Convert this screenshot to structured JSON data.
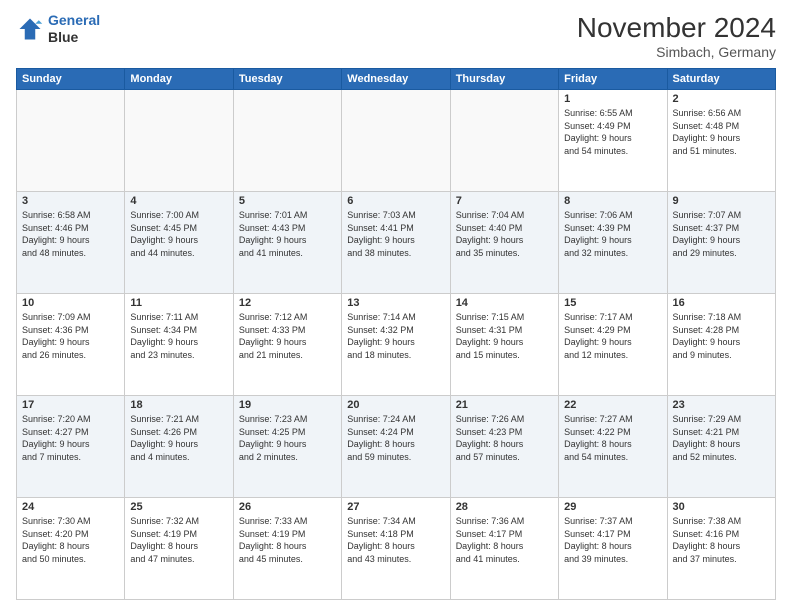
{
  "logo": {
    "line1": "General",
    "line2": "Blue"
  },
  "header": {
    "month_year": "November 2024",
    "location": "Simbach, Germany"
  },
  "weekdays": [
    "Sunday",
    "Monday",
    "Tuesday",
    "Wednesday",
    "Thursday",
    "Friday",
    "Saturday"
  ],
  "weeks": [
    [
      {
        "day": "",
        "info": ""
      },
      {
        "day": "",
        "info": ""
      },
      {
        "day": "",
        "info": ""
      },
      {
        "day": "",
        "info": ""
      },
      {
        "day": "",
        "info": ""
      },
      {
        "day": "1",
        "info": "Sunrise: 6:55 AM\nSunset: 4:49 PM\nDaylight: 9 hours\nand 54 minutes."
      },
      {
        "day": "2",
        "info": "Sunrise: 6:56 AM\nSunset: 4:48 PM\nDaylight: 9 hours\nand 51 minutes."
      }
    ],
    [
      {
        "day": "3",
        "info": "Sunrise: 6:58 AM\nSunset: 4:46 PM\nDaylight: 9 hours\nand 48 minutes."
      },
      {
        "day": "4",
        "info": "Sunrise: 7:00 AM\nSunset: 4:45 PM\nDaylight: 9 hours\nand 44 minutes."
      },
      {
        "day": "5",
        "info": "Sunrise: 7:01 AM\nSunset: 4:43 PM\nDaylight: 9 hours\nand 41 minutes."
      },
      {
        "day": "6",
        "info": "Sunrise: 7:03 AM\nSunset: 4:41 PM\nDaylight: 9 hours\nand 38 minutes."
      },
      {
        "day": "7",
        "info": "Sunrise: 7:04 AM\nSunset: 4:40 PM\nDaylight: 9 hours\nand 35 minutes."
      },
      {
        "day": "8",
        "info": "Sunrise: 7:06 AM\nSunset: 4:39 PM\nDaylight: 9 hours\nand 32 minutes."
      },
      {
        "day": "9",
        "info": "Sunrise: 7:07 AM\nSunset: 4:37 PM\nDaylight: 9 hours\nand 29 minutes."
      }
    ],
    [
      {
        "day": "10",
        "info": "Sunrise: 7:09 AM\nSunset: 4:36 PM\nDaylight: 9 hours\nand 26 minutes."
      },
      {
        "day": "11",
        "info": "Sunrise: 7:11 AM\nSunset: 4:34 PM\nDaylight: 9 hours\nand 23 minutes."
      },
      {
        "day": "12",
        "info": "Sunrise: 7:12 AM\nSunset: 4:33 PM\nDaylight: 9 hours\nand 21 minutes."
      },
      {
        "day": "13",
        "info": "Sunrise: 7:14 AM\nSunset: 4:32 PM\nDaylight: 9 hours\nand 18 minutes."
      },
      {
        "day": "14",
        "info": "Sunrise: 7:15 AM\nSunset: 4:31 PM\nDaylight: 9 hours\nand 15 minutes."
      },
      {
        "day": "15",
        "info": "Sunrise: 7:17 AM\nSunset: 4:29 PM\nDaylight: 9 hours\nand 12 minutes."
      },
      {
        "day": "16",
        "info": "Sunrise: 7:18 AM\nSunset: 4:28 PM\nDaylight: 9 hours\nand 9 minutes."
      }
    ],
    [
      {
        "day": "17",
        "info": "Sunrise: 7:20 AM\nSunset: 4:27 PM\nDaylight: 9 hours\nand 7 minutes."
      },
      {
        "day": "18",
        "info": "Sunrise: 7:21 AM\nSunset: 4:26 PM\nDaylight: 9 hours\nand 4 minutes."
      },
      {
        "day": "19",
        "info": "Sunrise: 7:23 AM\nSunset: 4:25 PM\nDaylight: 9 hours\nand 2 minutes."
      },
      {
        "day": "20",
        "info": "Sunrise: 7:24 AM\nSunset: 4:24 PM\nDaylight: 8 hours\nand 59 minutes."
      },
      {
        "day": "21",
        "info": "Sunrise: 7:26 AM\nSunset: 4:23 PM\nDaylight: 8 hours\nand 57 minutes."
      },
      {
        "day": "22",
        "info": "Sunrise: 7:27 AM\nSunset: 4:22 PM\nDaylight: 8 hours\nand 54 minutes."
      },
      {
        "day": "23",
        "info": "Sunrise: 7:29 AM\nSunset: 4:21 PM\nDaylight: 8 hours\nand 52 minutes."
      }
    ],
    [
      {
        "day": "24",
        "info": "Sunrise: 7:30 AM\nSunset: 4:20 PM\nDaylight: 8 hours\nand 50 minutes."
      },
      {
        "day": "25",
        "info": "Sunrise: 7:32 AM\nSunset: 4:19 PM\nDaylight: 8 hours\nand 47 minutes."
      },
      {
        "day": "26",
        "info": "Sunrise: 7:33 AM\nSunset: 4:19 PM\nDaylight: 8 hours\nand 45 minutes."
      },
      {
        "day": "27",
        "info": "Sunrise: 7:34 AM\nSunset: 4:18 PM\nDaylight: 8 hours\nand 43 minutes."
      },
      {
        "day": "28",
        "info": "Sunrise: 7:36 AM\nSunset: 4:17 PM\nDaylight: 8 hours\nand 41 minutes."
      },
      {
        "day": "29",
        "info": "Sunrise: 7:37 AM\nSunset: 4:17 PM\nDaylight: 8 hours\nand 39 minutes."
      },
      {
        "day": "30",
        "info": "Sunrise: 7:38 AM\nSunset: 4:16 PM\nDaylight: 8 hours\nand 37 minutes."
      }
    ]
  ]
}
